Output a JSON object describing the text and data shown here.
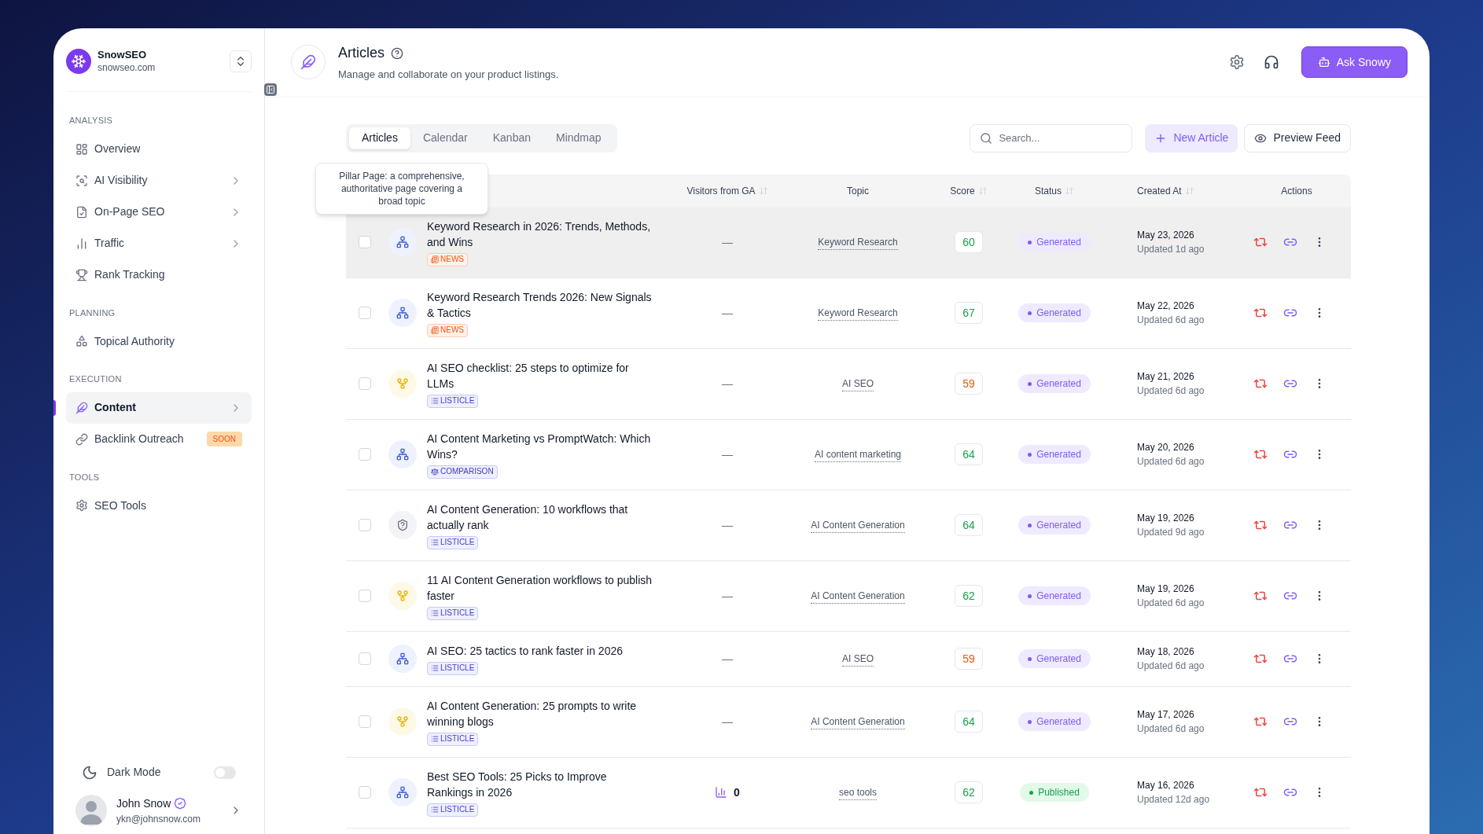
{
  "brand": {
    "name": "SnowSEO",
    "domain": "snowseo.com"
  },
  "sidebar": {
    "sections": [
      {
        "label": "ANALYSIS",
        "items": [
          {
            "kind": "overview",
            "label": "Overview",
            "selected": false,
            "expandable": false
          },
          {
            "kind": "visibility",
            "label": "AI Visibility",
            "selected": false,
            "expandable": true
          },
          {
            "kind": "onpage",
            "label": "On-Page SEO",
            "selected": false,
            "expandable": true
          },
          {
            "kind": "traffic",
            "label": "Traffic",
            "selected": false,
            "expandable": true
          },
          {
            "kind": "rank",
            "label": "Rank Tracking",
            "selected": false,
            "expandable": false
          }
        ]
      },
      {
        "label": "PLANNING",
        "items": [
          {
            "kind": "topical",
            "label": "Topical Authority",
            "selected": false,
            "expandable": false
          }
        ]
      },
      {
        "label": "EXECUTION",
        "items": [
          {
            "kind": "content",
            "label": "Content",
            "selected": true,
            "expandable": true
          },
          {
            "kind": "backlink",
            "label": "Backlink Outreach",
            "selected": false,
            "expandable": false,
            "badge": "SOON"
          }
        ]
      },
      {
        "label": "TOOLS",
        "items": [
          {
            "kind": "tools",
            "label": "SEO Tools",
            "selected": false,
            "expandable": false
          }
        ]
      }
    ]
  },
  "dark_mode": {
    "label": "Dark Mode",
    "on": false
  },
  "user": {
    "name": "John Snow",
    "email": "ykn@johnsnow.com",
    "verified": true
  },
  "header": {
    "title": "Articles",
    "subtitle": "Manage and collaborate on your product listings.",
    "ask_button": "Ask Snowy"
  },
  "tabs": [
    {
      "label": "Articles",
      "selected": true
    },
    {
      "label": "Calendar",
      "selected": false
    },
    {
      "label": "Kanban",
      "selected": false
    },
    {
      "label": "Mindmap",
      "selected": false
    }
  ],
  "search": {
    "placeholder": "Search..."
  },
  "new_button": "New Article",
  "preview_button": "Preview Feed",
  "tooltip": "Pillar Page: a comprehensive, authoritative page covering a broad topic",
  "table": {
    "columns": [
      {
        "label": "Visitors from GA",
        "sortable": true
      },
      {
        "label": "Topic",
        "sortable": false
      },
      {
        "label": "Score",
        "sortable": true
      },
      {
        "label": "Status",
        "sortable": true
      },
      {
        "label": "Created At",
        "sortable": true
      },
      {
        "label": "Actions",
        "sortable": false
      }
    ],
    "rows": [
      {
        "checked": false,
        "hovered": true,
        "kind": "pillar",
        "title": "Keyword Research in 2026: Trends, Methods, and Wins",
        "tag": {
          "kind": "news",
          "label": "NEWS"
        },
        "visitors": {
          "kind": "empty",
          "text": "—"
        },
        "topic": "Keyword Research",
        "score": {
          "text": "60",
          "color": "#16a34a"
        },
        "status": {
          "kind": "generated",
          "label": "Generated"
        },
        "created": "May 23, 2026",
        "updated": "Updated 1d ago"
      },
      {
        "checked": false,
        "hovered": false,
        "kind": "pillar",
        "title": "Keyword Research Trends 2026: New Signals & Tactics",
        "tag": {
          "kind": "news",
          "label": "NEWS"
        },
        "visitors": {
          "kind": "empty",
          "text": "—"
        },
        "topic": "Keyword Research",
        "score": {
          "text": "67",
          "color": "#16a34a"
        },
        "status": {
          "kind": "generated",
          "label": "Generated"
        },
        "created": "May 22, 2026",
        "updated": "Updated 6d ago"
      },
      {
        "checked": false,
        "hovered": false,
        "kind": "cluster",
        "title": "AI SEO checklist: 25 steps to optimize for LLMs",
        "tag": {
          "kind": "listicle",
          "label": "LISTICLE"
        },
        "visitors": {
          "kind": "empty",
          "text": "—"
        },
        "topic": "AI SEO",
        "score": {
          "text": "59",
          "color": "#ea580c"
        },
        "status": {
          "kind": "generated",
          "label": "Generated"
        },
        "created": "May 21, 2026",
        "updated": "Updated 6d ago"
      },
      {
        "checked": false,
        "hovered": false,
        "kind": "pillar",
        "title": "AI Content Marketing vs PromptWatch: Which Wins?",
        "tag": {
          "kind": "comparison",
          "label": "COMPARISON"
        },
        "visitors": {
          "kind": "empty",
          "text": "—"
        },
        "topic": "AI content marketing",
        "score": {
          "text": "64",
          "color": "#16a34a"
        },
        "status": {
          "kind": "generated",
          "label": "Generated"
        },
        "created": "May 20, 2026",
        "updated": "Updated 6d ago"
      },
      {
        "checked": false,
        "hovered": false,
        "kind": "unknown",
        "title": "AI Content Generation: 10 workflows that actually rank",
        "tag": {
          "kind": "listicle",
          "label": "LISTICLE"
        },
        "visitors": {
          "kind": "empty",
          "text": "—"
        },
        "topic": "AI Content Generation",
        "score": {
          "text": "64",
          "color": "#16a34a"
        },
        "status": {
          "kind": "generated",
          "label": "Generated"
        },
        "created": "May 19, 2026",
        "updated": "Updated 9d ago"
      },
      {
        "checked": false,
        "hovered": false,
        "kind": "cluster",
        "title": "11 AI Content Generation workflows to publish faster",
        "tag": {
          "kind": "listicle",
          "label": "LISTICLE"
        },
        "visitors": {
          "kind": "empty",
          "text": "—"
        },
        "topic": "AI Content Generation",
        "score": {
          "text": "62",
          "color": "#16a34a"
        },
        "status": {
          "kind": "generated",
          "label": "Generated"
        },
        "created": "May 19, 2026",
        "updated": "Updated 6d ago"
      },
      {
        "checked": false,
        "hovered": false,
        "kind": "pillar",
        "title": "AI SEO: 25 tactics to rank faster in 2026",
        "tag": {
          "kind": "listicle",
          "label": "LISTICLE"
        },
        "visitors": {
          "kind": "empty",
          "text": "—"
        },
        "topic": "AI SEO",
        "score": {
          "text": "59",
          "color": "#ea580c"
        },
        "status": {
          "kind": "generated",
          "label": "Generated"
        },
        "created": "May 18, 2026",
        "updated": "Updated 6d ago"
      },
      {
        "checked": false,
        "hovered": false,
        "kind": "cluster",
        "title": "AI Content Generation: 25 prompts to write winning blogs",
        "tag": {
          "kind": "listicle",
          "label": "LISTICLE"
        },
        "visitors": {
          "kind": "empty",
          "text": "—"
        },
        "topic": "AI Content Generation",
        "score": {
          "text": "64",
          "color": "#16a34a"
        },
        "status": {
          "kind": "generated",
          "label": "Generated"
        },
        "created": "May 17, 2026",
        "updated": "Updated 6d ago"
      },
      {
        "checked": false,
        "hovered": false,
        "kind": "pillar",
        "title": "Best SEO Tools: 25 Picks to Improve Rankings in 2026",
        "tag": {
          "kind": "listicle",
          "label": "LISTICLE"
        },
        "visitors": {
          "kind": "count",
          "text": "0"
        },
        "topic": "seo tools",
        "score": {
          "text": "62",
          "color": "#16a34a"
        },
        "status": {
          "kind": "published",
          "label": "Published"
        },
        "created": "May 16, 2026",
        "updated": "Updated 12d ago"
      }
    ]
  }
}
